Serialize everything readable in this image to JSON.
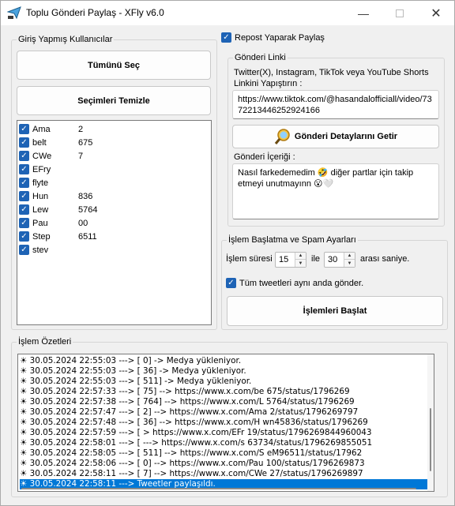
{
  "window": {
    "title": "Toplu Gönderi Paylaş - XFly v6.0",
    "minimize_glyph": "—",
    "close_glyph": "✕"
  },
  "users_group": {
    "legend": "Giriş Yapmış Kullanıcılar",
    "select_all_label": "Tümünü Seç",
    "clear_selection_label": "Seçimleri Temizle",
    "users": [
      {
        "name": "Ama",
        "tail": "2",
        "checked": true
      },
      {
        "name": "belt",
        "tail": "675",
        "checked": true
      },
      {
        "name": "CWe",
        "tail": "7",
        "checked": true
      },
      {
        "name": "EFry",
        "tail": "",
        "checked": true
      },
      {
        "name": "flyte",
        "tail": "",
        "checked": true
      },
      {
        "name": "Hun",
        "tail": "836",
        "checked": true
      },
      {
        "name": "Lew",
        "tail": "5764",
        "checked": true
      },
      {
        "name": "Pau",
        "tail": "00",
        "checked": true
      },
      {
        "name": "Step",
        "tail": "6511",
        "checked": true
      },
      {
        "name": "stev",
        "tail": "",
        "checked": true
      }
    ]
  },
  "repost": {
    "label": "Repost Yaparak Paylaş",
    "checked": true
  },
  "post_link": {
    "legend": "Gönderi Linki",
    "instruction": "Twitter(X), Instagram, TikTok veya YouTube Shorts Linkini Yapıştırın :",
    "url_value": "https://www.tiktok.com/@hasandalofficiall/video/7372213446252924166",
    "fetch_label": "Gönderi Detaylarını Getir",
    "content_label": "Gönderi İçeriği :",
    "content_value": "Nasıl farkedemedim 🤣 diğer partlar için takip etmeyi unutmayınn 😮🤍"
  },
  "settings": {
    "legend": "İşlem Başlatma ve Spam Ayarları",
    "duration_label": "İşlem süresi",
    "min_value": "15",
    "between_label": "ile",
    "max_value": "30",
    "range_suffix": "arası saniye.",
    "send_all_label": "Tüm tweetleri aynı anda gönder.",
    "send_all_checked": true,
    "start_label": "İşlemleri Başlat"
  },
  "log": {
    "legend": "İşlem Özetleri",
    "lines": [
      "30.05.2024 22:55:03 ---> [                    0] -> Medya yükleniyor.",
      "30.05.2024 22:55:03 ---> [                    36] -> Medya yükleniyor.",
      "30.05.2024 22:55:03 ---> [                    511] -> Medya yükleniyor.",
      "30.05.2024 22:57:33 ---> [                    75] --> https://www.x.com/be               675/status/1796269",
      "30.05.2024 22:57:38 ---> [                    764] --> https://www.x.com/L               5764/status/1796269",
      "30.05.2024 22:57:47 ---> [                    2] --> https://www.x.com/Ama               2/status/1796269797",
      "30.05.2024 22:57:48 ---> [                    36] --> https://www.x.com/H            wn45836/status/1796269",
      "30.05.2024 22:57:59 ---> [                    > https://www.x.com/EFr               19/status/1796269844960043",
      "30.05.2024 22:58:01 ---> [                    ---> https://www.x.com/s               63734/status/1796269855051",
      "30.05.2024 22:58:05 ---> [                    511] --> https://www.x.com/S               eM96511/status/17962",
      "30.05.2024 22:58:06 ---> [                    0] --> https://www.x.com/Pau               100/status/1796269873",
      "30.05.2024 22:58:11 ---> [                    7] --> https://www.x.com/CWe               27/status/1796269897",
      "30.05.2024 22:58:11 ---> Tweetler paylaşıldı."
    ],
    "selected_index": 12
  }
}
